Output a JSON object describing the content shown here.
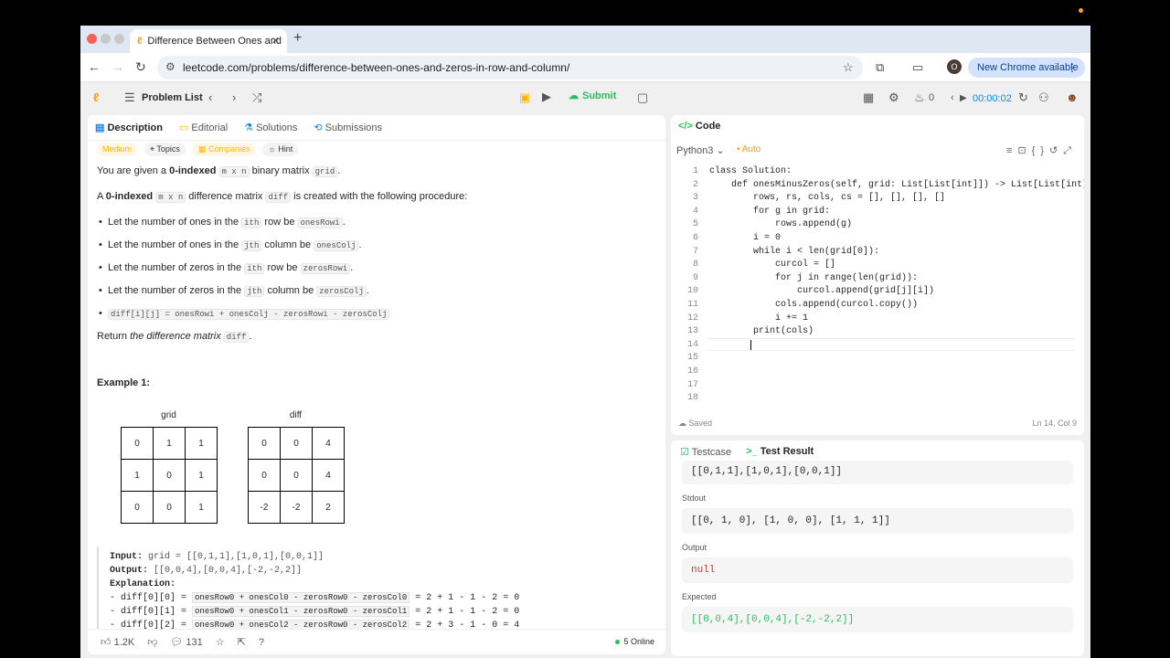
{
  "browser": {
    "tab_title": "Difference Between Ones and",
    "url": "leetcode.com/problems/difference-between-ones-and-zeros-in-row-and-column/",
    "new_chrome_label": "New Chrome available",
    "profile_initial": "O"
  },
  "topbar": {
    "problem_list": "Problem List",
    "submit": "Submit",
    "streak": "0",
    "timer": "00:00:02"
  },
  "left": {
    "tabs": [
      "Description",
      "Editorial",
      "Solutions",
      "Submissions"
    ],
    "tags": [
      "Medium",
      "Topics",
      "Companies",
      "Hint"
    ],
    "intro_pre": "You are given a ",
    "intro_bold": "0-indexed",
    "intro_code1": "m x n",
    "intro_mid": " binary matrix ",
    "intro_code2": "grid",
    "intro_post": ".",
    "line2_pre": "A ",
    "line2_bold": "0-indexed",
    "line2_code1": "m x n",
    "line2_mid": " difference matrix ",
    "line2_code2": "diff",
    "line2_post": " is created with the following procedure:",
    "bullets": [
      {
        "pre": "Let the number of ones in the ",
        "code": "ith",
        "mid": " row be ",
        "code2": "onesRowi",
        "post": "."
      },
      {
        "pre": "Let the number of ones in the ",
        "code": "jth",
        "mid": " column be ",
        "code2": "onesColj",
        "post": "."
      },
      {
        "pre": "Let the number of zeros in the ",
        "code": "ith",
        "mid": " row be ",
        "code2": "zerosRowi",
        "post": "."
      },
      {
        "pre": "Let the number of zeros in the ",
        "code": "jth",
        "mid": " column be ",
        "code2": "zerosColj",
        "post": "."
      }
    ],
    "formula": "diff[i][j] = onesRowi + onesColj - zerosRowi - zerosColj",
    "return_pre": "Return ",
    "return_em": "the difference matrix",
    "return_code": "diff",
    "return_post": ".",
    "example_title": "Example 1:",
    "grid_label": "grid",
    "diff_label": "diff",
    "grid": [
      [
        "0",
        "1",
        "1"
      ],
      [
        "1",
        "0",
        "1"
      ],
      [
        "0",
        "0",
        "1"
      ]
    ],
    "diff": [
      [
        "0",
        "0",
        "4"
      ],
      [
        "0",
        "0",
        "4"
      ],
      [
        "-2",
        "-2",
        "2"
      ]
    ],
    "input_label": "Input:",
    "input_val": "grid = [[0,1,1],[1,0,1],[0,0,1]]",
    "output_label": "Output:",
    "output_val": "[[0,0,4],[0,0,4],[-2,-2,2]]",
    "expl_label": "Explanation:",
    "expl1_pre": "- diff[0][0] = ",
    "expl1_chip": "onesRow0 + onesCol0 - zerosRow0 - zerosCol0",
    "expl1_post": " = 2 + 1 - 1 - 2 = 0",
    "expl2_pre": "- diff[0][1] = ",
    "expl2_chip": "onesRow0 + onesCol1 - zerosRow0 - zerosCol1",
    "expl2_post": " = 2 + 1 - 1 - 2 = 0",
    "expl3_pre": "- diff[0][2] = ",
    "expl3_chip": "onesRow0 + onesCol2 - zerosRow0 - zerosCol2",
    "expl3_post": " = 2 + 3 - 1 - 0 = 4",
    "likes": "1.2K",
    "comments": "131",
    "online": "5 Online"
  },
  "code": {
    "title": "Code",
    "language": "Python3",
    "auto": "Auto",
    "lines": [
      "class Solution:",
      "    def onesMinusZeros(self, grid: List[List[int]]) -> List[List[int]]:",
      "        rows, rs, cols, cs = [], [], [], []",
      "        for g in grid:",
      "            rows.append(g)",
      "        i = 0",
      "        while i < len(grid[0]):",
      "            curcol = []",
      "            for j in range(len(grid)):",
      "                curcol.append(grid[j][i])",
      "            cols.append(curcol.copy())",
      "            i += 1",
      "        print(cols)",
      "        ",
      "",
      "",
      "",
      ""
    ],
    "saved": "Saved",
    "cursor": "Ln 14, Col 9"
  },
  "results": {
    "tabs": [
      "Testcase",
      "Test Result"
    ],
    "input_val": "[[0,1,1],[1,0,1],[0,0,1]]",
    "stdout_label": "Stdout",
    "stdout_val": "[[0, 1, 0], [1, 0, 0], [1, 1, 1]]",
    "output_label": "Output",
    "output_val": "null",
    "expected_label": "Expected",
    "expected_val": "[[0,0,4],[0,0,4],[-2,-2,2]]"
  }
}
